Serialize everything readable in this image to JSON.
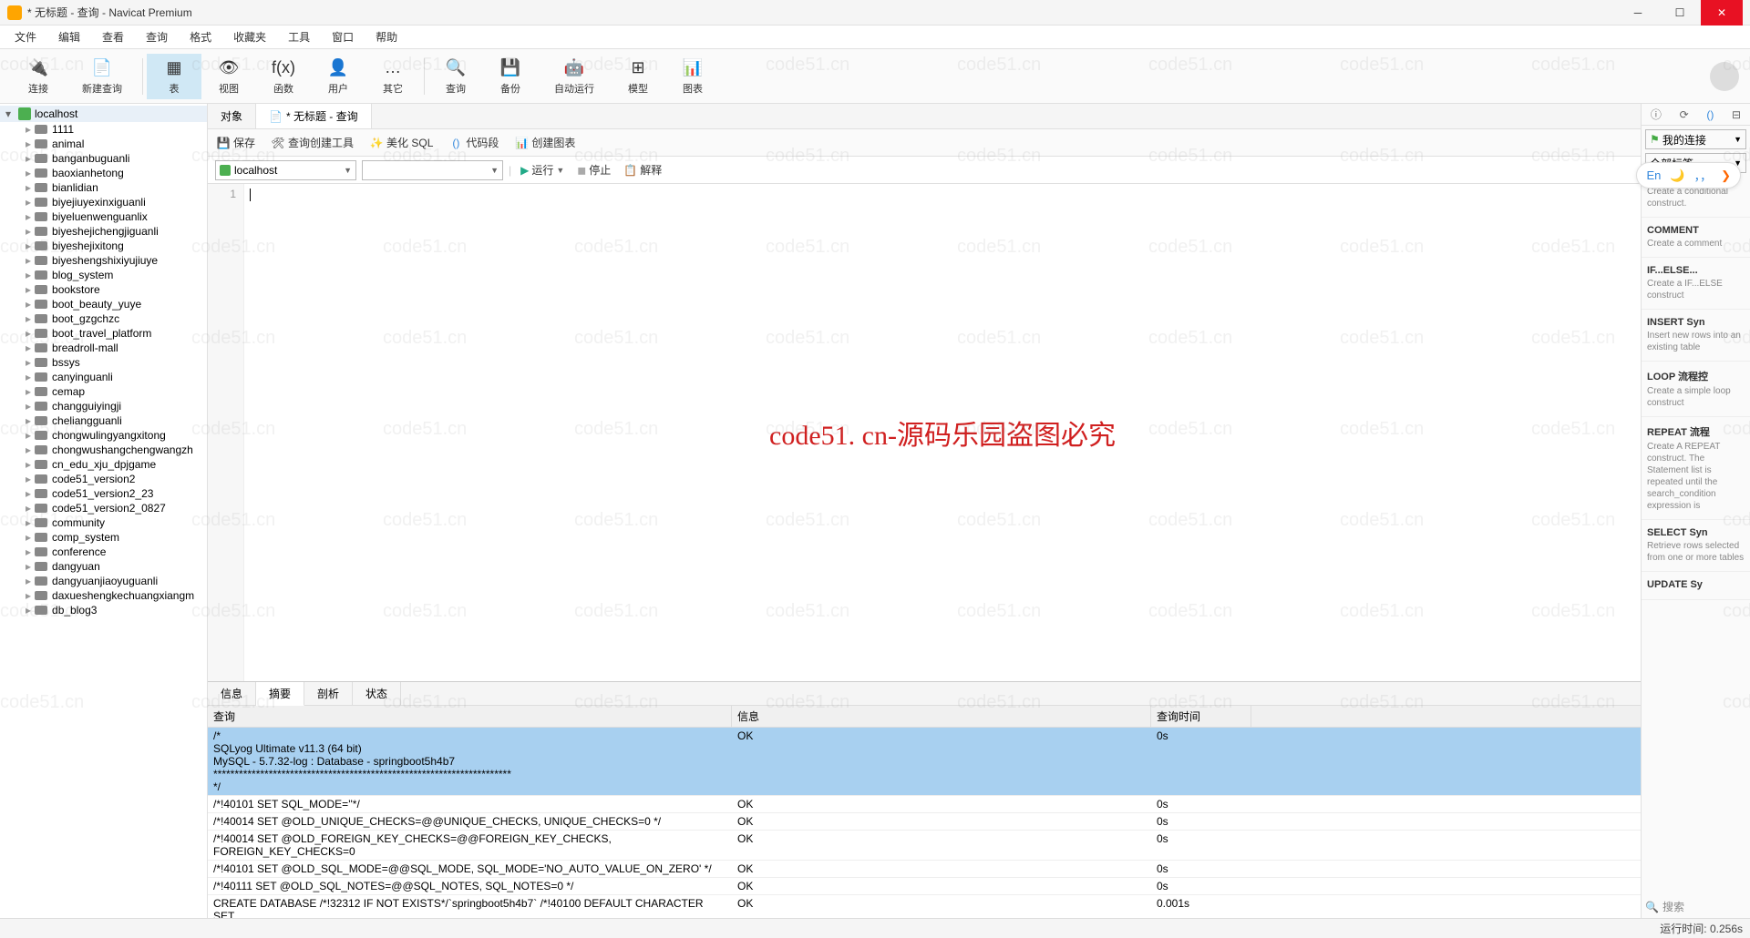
{
  "title": "* 无标题 - 查询 - Navicat Premium",
  "menu": [
    "文件",
    "编辑",
    "查看",
    "查询",
    "格式",
    "收藏夹",
    "工具",
    "窗口",
    "帮助"
  ],
  "toolbar": [
    {
      "label": "连接",
      "icon": "🔌",
      "active": false
    },
    {
      "label": "新建查询",
      "icon": "📄",
      "active": false
    },
    {
      "label": "表",
      "icon": "▦",
      "active": true
    },
    {
      "label": "视图",
      "icon": "👁",
      "active": false
    },
    {
      "label": "函数",
      "icon": "f(x)",
      "active": false
    },
    {
      "label": "用户",
      "icon": "👤",
      "active": false
    },
    {
      "label": "其它",
      "icon": "…",
      "active": false
    },
    {
      "label": "查询",
      "icon": "🔍",
      "active": false
    },
    {
      "label": "备份",
      "icon": "💾",
      "active": false
    },
    {
      "label": "自动运行",
      "icon": "🤖",
      "active": false
    },
    {
      "label": "模型",
      "icon": "⊞",
      "active": false
    },
    {
      "label": "图表",
      "icon": "📊",
      "active": false
    }
  ],
  "connection": "localhost",
  "databases": [
    "1111",
    "animal",
    "banganbuguanli",
    "baoxianhetong",
    "bianlidian",
    "biyejiuyexinxiguanli",
    "biyeluenwenguanlix",
    "biyeshejichengjiguanli",
    "biyeshejixitong",
    "biyeshengshixiyujiuye",
    "blog_system",
    "bookstore",
    "boot_beauty_yuye",
    "boot_gzgchzc",
    "boot_travel_platform",
    "breadroll-mall",
    "bssys",
    "canyinguanli",
    "cemap",
    "changguiyingji",
    "cheliangguanli",
    "chongwulingyangxitong",
    "chongwushangchengwangzh",
    "cn_edu_xju_dpjgame",
    "code51_version2",
    "code51_version2_23",
    "code51_version2_0827",
    "community",
    "comp_system",
    "conference",
    "dangyuan",
    "dangyuanjiaoyuguanli",
    "daxueshengkechuangxiangm",
    "db_blog3"
  ],
  "tabs": [
    {
      "label": "对象",
      "active": false
    },
    {
      "label": "* 无标题 - 查询",
      "active": true
    }
  ],
  "query_tools": {
    "save": "保存",
    "builder": "查询创建工具",
    "beautify": "美化 SQL",
    "snippet": "代码段",
    "chart": "创建图表"
  },
  "conn_dd": "localhost",
  "run_label": "运行",
  "stop_label": "停止",
  "explain_label": "解释",
  "editor_line": "1",
  "center_wm": "code51. cn-源码乐园盗图必究",
  "wm_text": "code51.cn",
  "res_tabs": [
    "信息",
    "摘要",
    "剖析",
    "状态"
  ],
  "res_tabs_active": 1,
  "res_cols": {
    "q": "查询",
    "i": "信息",
    "t": "查询时间"
  },
  "res_rows": [
    {
      "q": "/*\nSQLyog Ultimate v11.3 (64 bit)\nMySQL - 5.7.32-log : Database - springboot5h4b7\n**********************************************************************\n*/",
      "i": "OK",
      "t": "0s",
      "sel": true
    },
    {
      "q": "/*!40101 SET SQL_MODE=''*/",
      "i": "OK",
      "t": "0s"
    },
    {
      "q": "/*!40014 SET @OLD_UNIQUE_CHECKS=@@UNIQUE_CHECKS, UNIQUE_CHECKS=0 */",
      "i": "OK",
      "t": "0s"
    },
    {
      "q": "/*!40014 SET @OLD_FOREIGN_KEY_CHECKS=@@FOREIGN_KEY_CHECKS, FOREIGN_KEY_CHECKS=0",
      "i": "OK",
      "t": "0s"
    },
    {
      "q": "/*!40101 SET @OLD_SQL_MODE=@@SQL_MODE, SQL_MODE='NO_AUTO_VALUE_ON_ZERO' */",
      "i": "OK",
      "t": "0s"
    },
    {
      "q": "/*!40111 SET @OLD_SQL_NOTES=@@SQL_NOTES, SQL_NOTES=0 */",
      "i": "OK",
      "t": "0s"
    },
    {
      "q": "CREATE DATABASE /*!32312 IF NOT EXISTS*/`springboot5h4b7` /*!40100 DEFAULT CHARACTER SET",
      "i": "OK",
      "t": "0.001s"
    }
  ],
  "right": {
    "my_conn": "我的连接",
    "all_tags": "全部标签",
    "items": [
      {
        "title": "",
        "desc": "Create a conditional construct."
      },
      {
        "title": "COMMENT",
        "desc": "Create a comment"
      },
      {
        "title": "IF...ELSE...",
        "desc": "Create a IF...ELSE construct"
      },
      {
        "title": "INSERT Syn",
        "desc": "Insert new rows into an existing table"
      },
      {
        "title": "LOOP 流程控",
        "desc": "Create a simple loop construct"
      },
      {
        "title": "REPEAT 流程",
        "desc": "Create A REPEAT construct. The Statement list is repeated until the search_condition expression is"
      },
      {
        "title": "SELECT Syn",
        "desc": "Retrieve rows selected from one or more tables"
      },
      {
        "title": "UPDATE Sy",
        "desc": ""
      }
    ],
    "search": "搜索"
  },
  "lang": {
    "en": "En",
    "moon": "🌙",
    "quote": "，，",
    "arrow": "❯"
  },
  "status": {
    "runtime": "运行时间: 0.256s"
  }
}
